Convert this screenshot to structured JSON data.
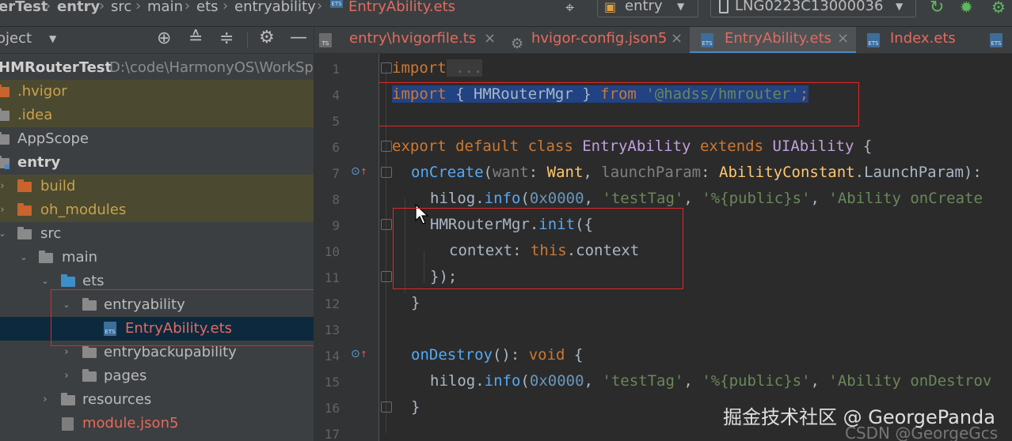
{
  "navbar": {
    "crumbs": [
      "erTest",
      "entry",
      "src",
      "main",
      "ets",
      "entryability",
      "EntryAbility.ets"
    ],
    "run_config": "entry",
    "device": "LNG0223C13000036"
  },
  "project_panel": {
    "title": "oject",
    "root_name": "HMRouterTest",
    "root_path": "D:\\code\\HarmonyOS\\WorkSpa",
    "items": [
      {
        "label": ".hvigor"
      },
      {
        "label": ".idea"
      },
      {
        "label": "AppScope"
      },
      {
        "label": "entry"
      },
      {
        "label": "build"
      },
      {
        "label": "oh_modules"
      },
      {
        "label": "src"
      },
      {
        "label": "main"
      },
      {
        "label": "ets"
      },
      {
        "label": "entryability"
      },
      {
        "label": "EntryAbility.ets"
      },
      {
        "label": "entrybackupability"
      },
      {
        "label": "pages"
      },
      {
        "label": "resources"
      },
      {
        "label": "module.json5"
      }
    ]
  },
  "tabs": [
    {
      "label": "entry\\hvigorfile.ts"
    },
    {
      "label": "hvigor-config.json5"
    },
    {
      "label": "EntryAbility.ets"
    },
    {
      "label": "Index.ets"
    }
  ],
  "editor": {
    "line_numbers": [
      "1",
      "4",
      "5",
      "6",
      "7",
      "8",
      "9",
      "10",
      "11",
      "12",
      "13",
      "14",
      "15",
      "16",
      "17"
    ],
    "l1": {
      "kw": "import",
      "rest": " ..."
    },
    "l4": {
      "kw": "import",
      "p1": " { HMRouterMgr } ",
      "from": "from",
      "sp": " ",
      "str": "'@hadss/hmrouter'",
      "end": ";"
    },
    "l6": {
      "kw": "export default class ",
      "cls": "EntryAbility",
      "ext": " extends ",
      "base": "UIAbility",
      "end": " {"
    },
    "l7": {
      "fn": "onCreate",
      "p0": "(",
      "a1": "want",
      "c1": ": ",
      "t1": "Want",
      "c2": ", ",
      "a2": "launchParam",
      "c3": ": ",
      "t2": "AbilityConstant",
      "dot": ".",
      "t3": "LaunchParam",
      "end": "):"
    },
    "l8": {
      "obj": "hilog",
      "dot": ".",
      "fn": "info",
      "p0": "(",
      "num": "0x0000",
      "c1": ", ",
      "s1": "'testTag'",
      "c2": ", ",
      "s2": "'%{public}s'",
      "c3": ", ",
      "s3": "'Ability onCreate"
    },
    "l9": {
      "obj": "HMRouterMgr",
      "dot": ".",
      "fn": "init",
      "end": "({"
    },
    "l10": {
      "prop": "context",
      "c1": ": ",
      "kw": "this",
      "end": ".context"
    },
    "l11": {
      "text": "});"
    },
    "l12": {
      "text": "}"
    },
    "l14": {
      "fn": "onDestroy",
      "p0": "(): ",
      "kw": "void",
      "end": " {"
    },
    "l15": {
      "obj": "hilog",
      "dot": ".",
      "fn": "info",
      "p0": "(",
      "num": "0x0000",
      "c1": ", ",
      "s1": "'testTag'",
      "c2": ", ",
      "s2": "'%{public}s'",
      "c3": ", ",
      "s3": "'Ability onDestrov"
    },
    "l16": {
      "text": "}"
    }
  },
  "watermark": {
    "main": "掘金技术社区 @ GeorgePanda",
    "sub": "CSDN @GeorgeGcs"
  },
  "colors": {
    "highlight_box": "#e02828",
    "selection": "#214283",
    "active_tab_underline": "#4a88c7"
  }
}
